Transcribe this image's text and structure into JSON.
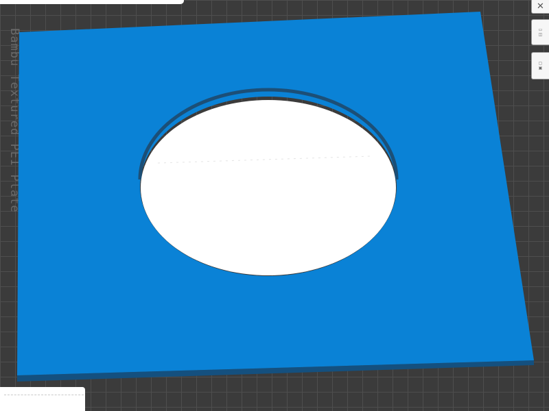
{
  "plate": {
    "label": "Bambu Textured PEI Plate",
    "grid_color": "#4e4e4e",
    "surface_color": "#3b3b3b"
  },
  "model": {
    "color": "#0a82d6",
    "hole_color": "#ffffff",
    "edge_color": "#1a4d74",
    "shape": "square plate with circular hole"
  },
  "toolbar": {
    "close_icon": "close-icon",
    "arrange_icon": "arrange-icon",
    "orient_icon": "orient-icon"
  }
}
